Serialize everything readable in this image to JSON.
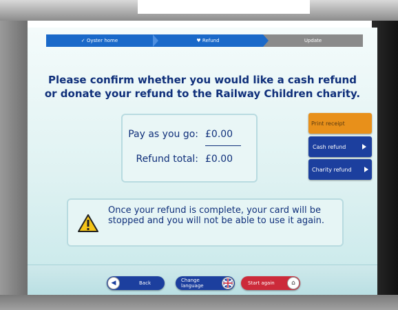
{
  "progress": {
    "steps": [
      {
        "label": "✓ Oyster home",
        "state": "complete"
      },
      {
        "label": "♥ Refund",
        "state": "current"
      },
      {
        "label": "Update",
        "state": "upcoming"
      }
    ]
  },
  "main": {
    "question_line1": "Please confirm whether you would like a cash refund",
    "question_line2": "or donate your refund to the Railway Children charity."
  },
  "summary": {
    "pay_as_you_go_label": "Pay as you go:",
    "pay_as_you_go_value": "£0.00",
    "refund_total_label": "Refund total:",
    "refund_total_value": "£0.00"
  },
  "actions": {
    "print_receipt": "Print receipt",
    "cash_refund": "Cash refund",
    "charity_refund": "Charity refund"
  },
  "warning": {
    "icon": "warning-triangle-icon",
    "text": "Once your refund is complete, your card will be stopped and you will not be able to use it again."
  },
  "footer": {
    "back": "Back",
    "change_language": "Change language",
    "start_again": "Start again"
  },
  "colors": {
    "primary_blue": "#1c3f9e",
    "progress_blue": "#1a69c9",
    "print_orange": "#e8901a",
    "start_again_red": "#cc2a3a",
    "text_navy": "#0f2f7a"
  }
}
